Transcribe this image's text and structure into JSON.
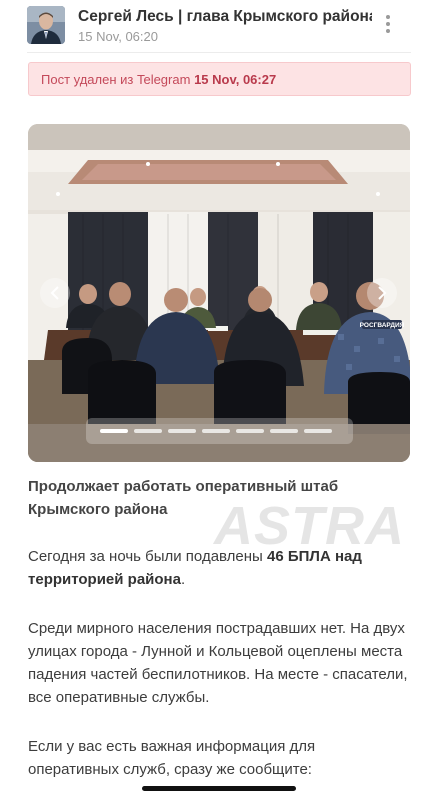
{
  "header": {
    "channel_title": "Сергей Лесь | глава Крымского района",
    "date": "15 Nov, 06:20",
    "menu_icon": "more-vertical-icon"
  },
  "deleted_notice": {
    "prefix": "Пост удален из Telegram",
    "date": "15 Nov, 06:27"
  },
  "gallery": {
    "slide_count": 7,
    "active_slide": 1,
    "prev_icon": "chevron-left-icon",
    "next_icon": "chevron-right-icon",
    "patch_text": "РОСГВАРДИЯ"
  },
  "post": {
    "paragraph_1": "Продолжает работать оперативный штаб Крымского района",
    "paragraph_2_start": "Сегодня за ночь были подавлены",
    "paragraph_2_bold": "46 БПЛА над территорией района",
    "paragraph_2_end": ".",
    "paragraph_3": "Среди мирного населения пострадавших нет. На двух улицах города - Лунной и Кольцевой оцеплены места падения частей беспилотников. На месте - спасатели, все оперативные службы.",
    "paragraph_4": "Если у вас есть важная информация для оперативных служб, сразу же сообщите:"
  },
  "watermark": {
    "text": "ASTRA"
  }
}
